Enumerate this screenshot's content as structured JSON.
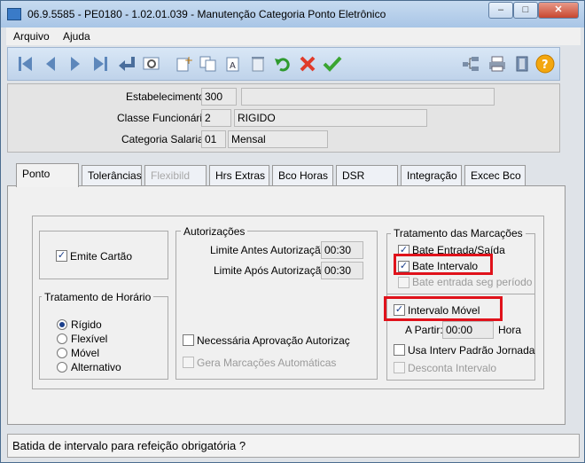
{
  "window": {
    "title": "06.9.5585 - PE0180 - 1.02.01.039 - Manutenção Categoria Ponto Eletrônico"
  },
  "menu": [
    "Arquivo",
    "Ajuda"
  ],
  "toolbar_icons": [
    "first-record-icon",
    "previous-record-icon",
    "next-record-icon",
    "last-record-icon",
    "goto-icon",
    "query-icon",
    "new-icon",
    "copy-icon",
    "edit-icon",
    "delete-icon",
    "undo-icon",
    "cancel-icon",
    "save-icon",
    "tree-icon",
    "print-icon",
    "exit-icon",
    "help-icon"
  ],
  "header": {
    "estabelecimento": {
      "label": "Estabelecimento:",
      "code": "300",
      "desc": ""
    },
    "classe": {
      "label": "Classe Funcionário:",
      "code": "2",
      "desc": "RIGIDO"
    },
    "categoria": {
      "label": "Categoria Salarial:",
      "code": "01",
      "desc": "Mensal"
    }
  },
  "tabs": [
    {
      "label": "Ponto",
      "state": "active"
    },
    {
      "label": "Tolerâncias",
      "state": "normal"
    },
    {
      "label": "Flexibild",
      "state": "disabled"
    },
    {
      "label": "Hrs Extras",
      "state": "normal"
    },
    {
      "label": "Bco Horas",
      "state": "normal"
    },
    {
      "label": "DSR",
      "state": "normal"
    },
    {
      "label": "Integração",
      "state": "normal"
    },
    {
      "label": "Excec Bco",
      "state": "normal"
    }
  ],
  "ponto": {
    "emite_cartao": {
      "label": "Emite Cartão",
      "checked": true
    },
    "tratamento_horario": {
      "title": "Tratamento de Horário",
      "options": [
        "Rígido",
        "Flexível",
        "Móvel",
        "Alternativo"
      ],
      "selected": "Rígido"
    },
    "autorizacoes": {
      "title": "Autorizações",
      "limite_antes": {
        "label": "Limite Antes Autorização:",
        "value": "00:30"
      },
      "limite_apos": {
        "label": "Limite Após Autorização:",
        "value": "00:30"
      },
      "necessaria_aprovacao": {
        "label": "Necessária Aprovação Autorizaç",
        "checked": false
      },
      "gera_marcacoes": {
        "label": "Gera Marcações Automáticas",
        "checked": false,
        "disabled": true
      }
    },
    "tratamento_marcacoes": {
      "title": "Tratamento das Marcações",
      "bate_entrada_saida": {
        "label": "Bate Entrada/Saída",
        "checked": true
      },
      "bate_intervalo": {
        "label": "Bate Intervalo",
        "checked": true
      },
      "bate_entrada_seg": {
        "label": "Bate entrada seg período",
        "checked": false,
        "disabled": true
      }
    },
    "intervalo": {
      "intervalo_movel": {
        "label": "Intervalo Móvel",
        "checked": true
      },
      "a_partir": {
        "label": "A Partir:",
        "value": "00:00",
        "unit": "Hora"
      },
      "usa_interv_padrao": {
        "label": "Usa Interv Padrão Jornada",
        "checked": false
      },
      "desconta_intervalo": {
        "label": "Desconta Intervalo",
        "checked": false,
        "disabled": true
      }
    }
  },
  "status": {
    "text": "Batida de intervalo para refeição obrigatória ?"
  },
  "colors": {
    "highlight": "#e0121b",
    "titlebar": "#b8d0ec"
  }
}
